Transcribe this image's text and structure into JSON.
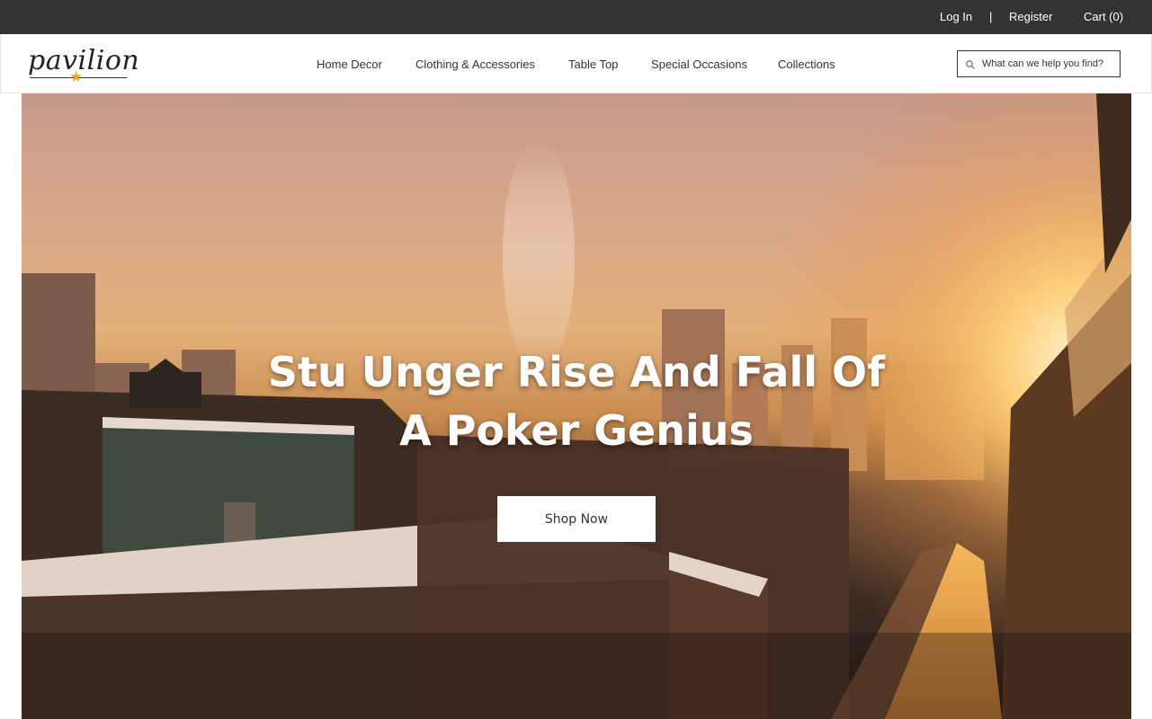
{
  "topbar": {
    "login": "Log In",
    "separator": "|",
    "register": "Register",
    "cart": "Cart (0)"
  },
  "header": {
    "logo_text": "pavilion",
    "logo_star": "★",
    "nav": [
      "Home Decor",
      "Clothing & Accessories",
      "Table Top",
      "Special Occasions",
      "Collections"
    ],
    "search": {
      "placeholder": "What can we help you find?",
      "icon": "search-icon"
    }
  },
  "hero": {
    "title": "Stu Unger Rise And Fall Of A Poker Genius",
    "button": "Shop Now"
  },
  "colors": {
    "topbar_bg": "#333333",
    "accent_star": "#e8a33a",
    "text_dark": "#333333"
  }
}
